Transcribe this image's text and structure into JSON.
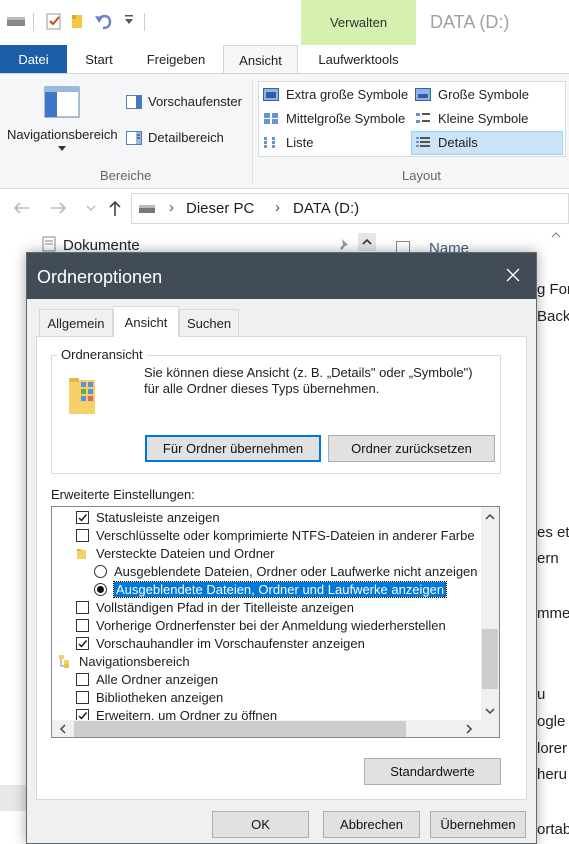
{
  "qat": {
    "undo_icon": "undo-icon"
  },
  "title": {
    "context_tab": "Verwalten",
    "window_title": "DATA (D:)"
  },
  "ribbon_tabs": [
    "Datei",
    "Start",
    "Freigeben",
    "Ansicht",
    "Laufwerktools"
  ],
  "ribbon": {
    "nav_pane_label": "Navigationsbereich",
    "preview_label": "Vorschaufenster",
    "details_pane_label": "Detailbereich",
    "group_panes": "Bereiche",
    "layout_items": [
      "Extra große Symbole",
      "Große Symbole",
      "Mittelgroße Symbole",
      "Kleine Symbole",
      "Liste",
      "Details"
    ],
    "group_layout": "Layout"
  },
  "address": {
    "crumbs": [
      "Dieser PC",
      "DATA (D:)"
    ]
  },
  "background": {
    "sidebar_item": "Dokumente",
    "col_name": "Name",
    "right_snippets": [
      "g For",
      "Back",
      "es et",
      "ern",
      "mme",
      "u",
      "ogle",
      "lorer",
      "heru",
      "ortab"
    ]
  },
  "dialog": {
    "title": "Ordneroptionen",
    "tabs": [
      "Allgemein",
      "Ansicht",
      "Suchen"
    ],
    "folder_view_legend": "Ordneransicht",
    "folder_view_text_1": "Sie können diese Ansicht (z. B. „Details\" oder „Symbole\")",
    "folder_view_text_2": "für alle Ordner dieses Typs übernehmen.",
    "apply_btn": "Für Ordner übernehmen",
    "reset_btn": "Ordner zurücksetzen",
    "advanced_label": "Erweiterte Einstellungen:",
    "settings": [
      {
        "type": "check",
        "checked": true,
        "indent": 1,
        "label": "Statusleiste anzeigen"
      },
      {
        "type": "check",
        "checked": false,
        "indent": 1,
        "label": "Verschlüsselte oder komprimierte NTFS-Dateien in anderer Farbe"
      },
      {
        "type": "folder",
        "indent": 1,
        "label": "Versteckte Dateien und Ordner"
      },
      {
        "type": "radio",
        "checked": false,
        "indent": 2,
        "label": "Ausgeblendete Dateien, Ordner oder Laufwerke nicht anzeigen"
      },
      {
        "type": "radio",
        "checked": true,
        "indent": 2,
        "selected": true,
        "label": "Ausgeblendete Dateien, Ordner und Laufwerke anzeigen"
      },
      {
        "type": "check",
        "checked": false,
        "indent": 1,
        "label": "Vollständigen Pfad in der Titelleiste anzeigen"
      },
      {
        "type": "check",
        "checked": false,
        "indent": 1,
        "label": "Vorherige Ordnerfenster bei der Anmeldung wiederherstellen"
      },
      {
        "type": "check",
        "checked": true,
        "indent": 1,
        "label": "Vorschauhandler im Vorschaufenster anzeigen"
      },
      {
        "type": "navfolder",
        "indent": 0,
        "label": "Navigationsbereich"
      },
      {
        "type": "check",
        "checked": false,
        "indent": 1,
        "label": "Alle Ordner anzeigen"
      },
      {
        "type": "check",
        "checked": false,
        "indent": 1,
        "label": "Bibliotheken anzeigen"
      },
      {
        "type": "check",
        "checked": true,
        "indent": 1,
        "label": "Erweitern, um Ordner zu öffnen"
      }
    ],
    "defaults_btn": "Standardwerte",
    "ok_btn": "OK",
    "cancel_btn": "Abbrechen",
    "apply_main_btn": "Übernehmen"
  }
}
